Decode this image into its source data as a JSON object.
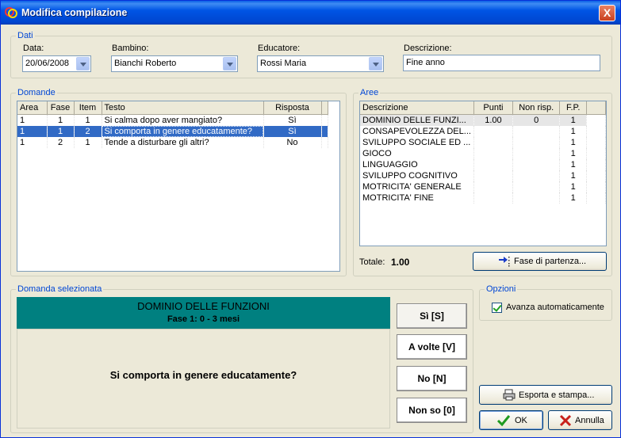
{
  "window": {
    "title": "Modifica compilazione",
    "close_label": "X"
  },
  "dati": {
    "legend": "Dati",
    "data_label": "Data:",
    "data_value": "20/06/2008",
    "bambino_label": "Bambino:",
    "bambino_value": "Bianchi Roberto",
    "educatore_label": "Educatore:",
    "educatore_value": "Rossi Maria",
    "descrizione_label": "Descrizione:",
    "descrizione_value": "Fine anno"
  },
  "domande": {
    "legend": "Domande",
    "columns": [
      "Area",
      "Fase",
      "Item",
      "Testo",
      "Risposta"
    ],
    "rows": [
      {
        "area": "1",
        "fase": "1",
        "item": "1",
        "testo": "Si calma dopo aver mangiato?",
        "risposta": "Sì"
      },
      {
        "area": "1",
        "fase": "1",
        "item": "2",
        "testo": "Si comporta in genere educatamente?",
        "risposta": "Sì"
      },
      {
        "area": "1",
        "fase": "2",
        "item": "1",
        "testo": "Tende a disturbare gli altri?",
        "risposta": "No"
      }
    ]
  },
  "aree": {
    "legend": "Aree",
    "columns": [
      "Descrizione",
      "Punti",
      "Non risp.",
      "F.P."
    ],
    "rows": [
      {
        "descrizione": "DOMINIO DELLE FUNZI...",
        "punti": "1.00",
        "non_risp": "0",
        "fp": "1"
      },
      {
        "descrizione": "CONSAPEVOLEZZA DEL...",
        "punti": "",
        "non_risp": "",
        "fp": "1"
      },
      {
        "descrizione": "SVILUPPO SOCIALE ED ...",
        "punti": "",
        "non_risp": "",
        "fp": "1"
      },
      {
        "descrizione": "GIOCO",
        "punti": "",
        "non_risp": "",
        "fp": "1"
      },
      {
        "descrizione": "LINGUAGGIO",
        "punti": "",
        "non_risp": "",
        "fp": "1"
      },
      {
        "descrizione": "SVILUPPO COGNITIVO",
        "punti": "",
        "non_risp": "",
        "fp": "1"
      },
      {
        "descrizione": "MOTRICITA' GENERALE",
        "punti": "",
        "non_risp": "",
        "fp": "1"
      },
      {
        "descrizione": "MOTRICITA' FINE",
        "punti": "",
        "non_risp": "",
        "fp": "1"
      }
    ],
    "totale_label": "Totale:",
    "totale_value": "1.00",
    "fase_button": "Fase di partenza..."
  },
  "domanda_selezionata": {
    "legend": "Domanda selezionata",
    "area_title": "DOMINIO DELLE FUNZIONI",
    "fase_subtitle": "Fase 1: 0 - 3 mesi",
    "question": "Si comporta in genere educatamente?",
    "answers": [
      "Sì [S]",
      "A volte [V]",
      "No [N]",
      "Non so [0]"
    ]
  },
  "opzioni": {
    "legend": "Opzioni",
    "avanza_label": "Avanza automaticamente",
    "avanza_checked": true
  },
  "footer": {
    "esporta_label": "Esporta e stampa...",
    "ok_label": "OK",
    "annulla_label": "Annulla"
  },
  "colors": {
    "title_bar": "#0055e5",
    "header_panel": "#008080",
    "selection": "#316ac5"
  }
}
